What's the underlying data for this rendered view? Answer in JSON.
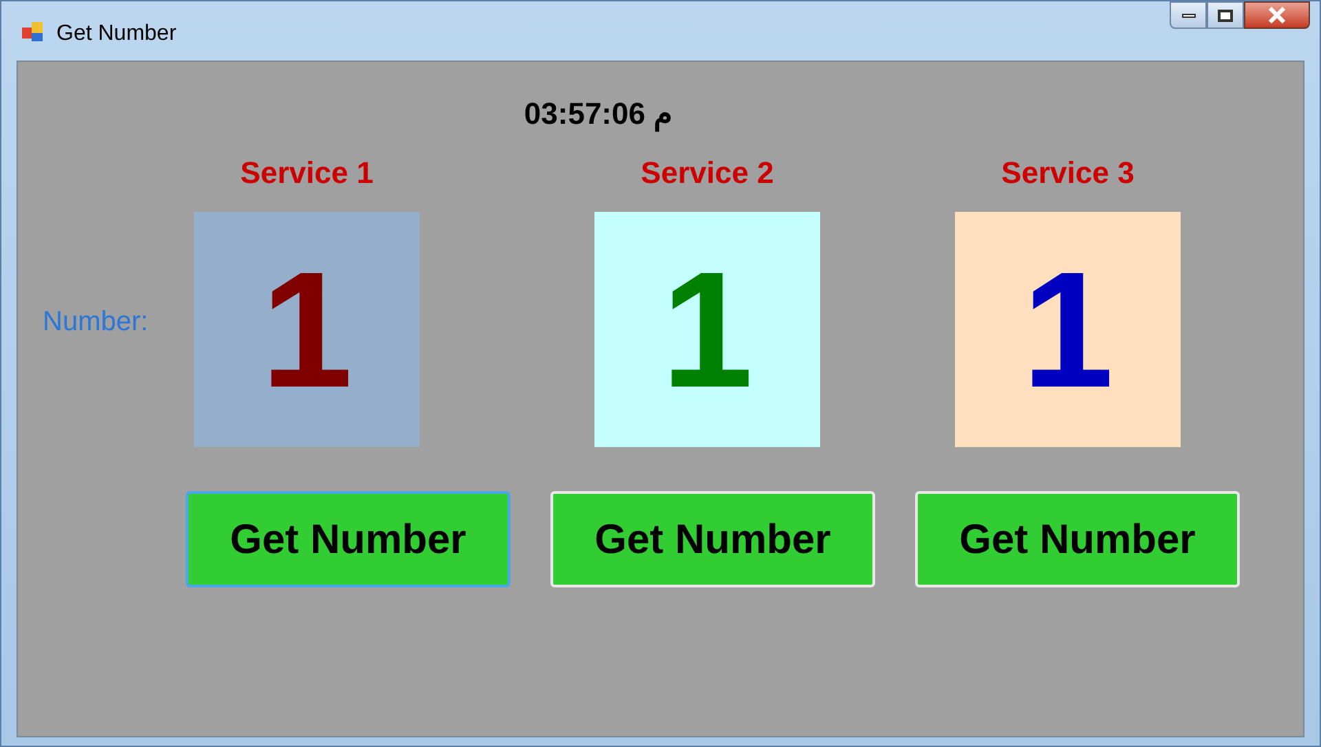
{
  "window": {
    "title": "Get Number"
  },
  "clock": "03:57:06 م",
  "number_label": "Number:",
  "services": [
    {
      "title": "Service 1",
      "number": "1",
      "color": "#800000",
      "box": {
        "color": "#94aecb"
      },
      "button": {
        "label": "Get Number",
        "focused": true
      }
    },
    {
      "title": "Service 2",
      "number": "1",
      "color": "#008000",
      "box": {
        "color": "#c4fdfd"
      },
      "button": {
        "label": "Get Number",
        "focused": false
      }
    },
    {
      "title": "Service 3",
      "number": "1",
      "color": "#0000c0",
      "box": {
        "color": "#ffdfbd"
      },
      "button": {
        "label": "Get Number",
        "focused": false
      }
    }
  ]
}
